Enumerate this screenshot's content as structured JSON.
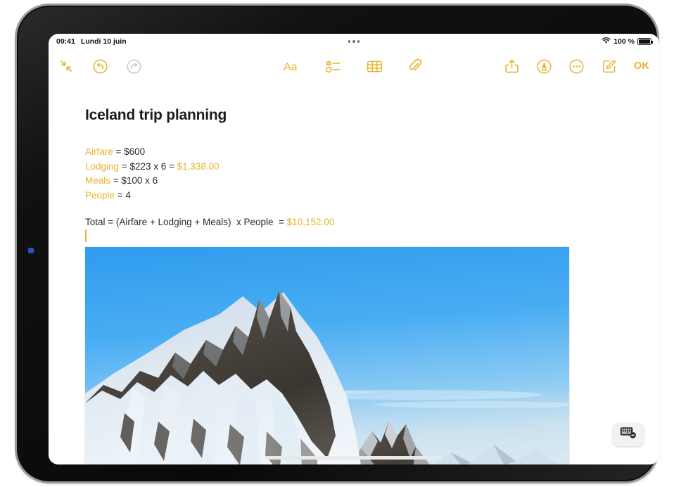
{
  "status_bar": {
    "time": "09:41",
    "date": "Lundi 10 juin",
    "battery_percent": "100 %",
    "wifi_icon": "wifi-icon",
    "battery_icon": "battery-full-icon",
    "multitask_handle": "multitasking-dots-icon"
  },
  "toolbar": {
    "left": [
      {
        "name": "collapse-button",
        "icon": "collapse-arrows-icon",
        "label": "Collapse",
        "enabled": true
      },
      {
        "name": "undo-button",
        "icon": "undo-circle-icon",
        "label": "Undo",
        "enabled": true
      },
      {
        "name": "redo-button",
        "icon": "redo-circle-icon",
        "label": "Redo",
        "enabled": false
      }
    ],
    "center": [
      {
        "name": "format-button",
        "icon": "aa-text-format-icon",
        "label": "Aa"
      },
      {
        "name": "checklist-button",
        "icon": "checklist-icon",
        "label": "Checklist"
      },
      {
        "name": "table-button",
        "icon": "table-grid-icon",
        "label": "Table"
      },
      {
        "name": "attachment-button",
        "icon": "paperclip-icon",
        "label": "Attach"
      }
    ],
    "right": [
      {
        "name": "share-button",
        "icon": "share-up-arrow-icon",
        "label": "Share"
      },
      {
        "name": "markup-button",
        "icon": "markup-pen-circle-icon",
        "label": "Markup"
      },
      {
        "name": "more-button",
        "icon": "ellipsis-circle-icon",
        "label": "More"
      },
      {
        "name": "compose-button",
        "icon": "compose-pencil-square-icon",
        "label": "New Note"
      }
    ],
    "done_label": "OK"
  },
  "note": {
    "title": "Iceland trip planning",
    "lines": [
      {
        "variable": "Airfare",
        "expression": " = $600",
        "result": ""
      },
      {
        "variable": "Lodging",
        "expression": " = $223 x 6  = ",
        "result": "$1,338.00"
      },
      {
        "variable": "Meals",
        "expression": " = $100 x 6",
        "result": ""
      },
      {
        "variable": "People",
        "expression": " = 4",
        "result": ""
      }
    ],
    "total": {
      "expression": "Total = (Airfare + Lodging + Meals)  x People  = ",
      "result": "$10,152.00"
    },
    "photo_alt": "Snow-covered mountain peaks under a clear blue sky in Iceland"
  },
  "keyboard_dismiss": {
    "name": "hide-keyboard-button",
    "icon": "keyboard-dismiss-icon"
  },
  "colors": {
    "accent": "#e7b42e",
    "text": "#2b2b2b",
    "title": "#1b1b1b",
    "disabled": "#c9c9c9",
    "sky": "#3fa4f0",
    "snow": "#e9f1f8"
  }
}
